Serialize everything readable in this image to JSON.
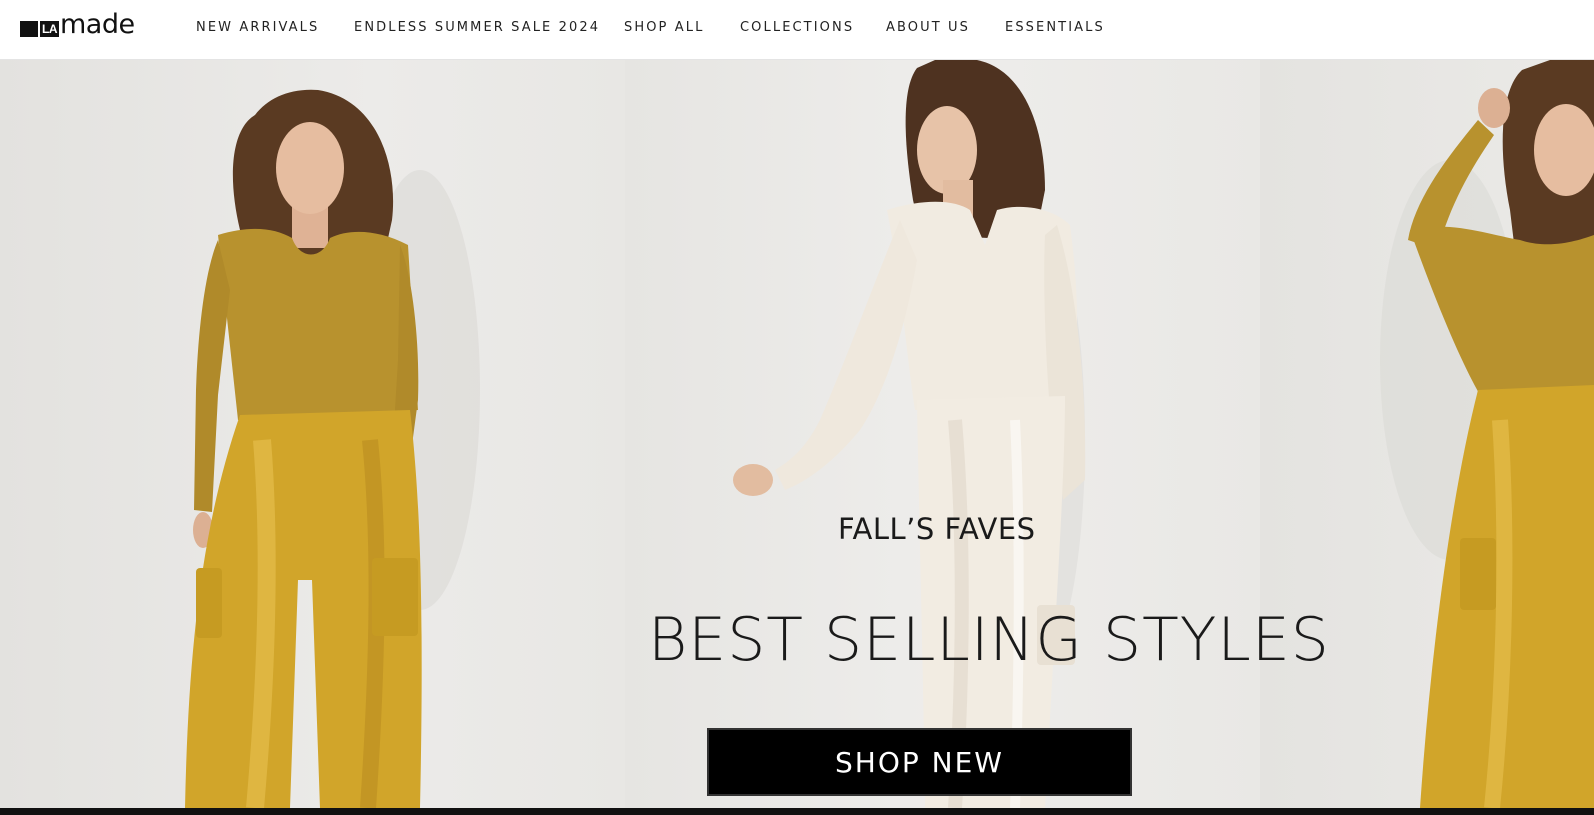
{
  "brand": {
    "logo_la": "LA",
    "logo_made": "made"
  },
  "nav": {
    "items": [
      {
        "label": "NEW ARRIVALS"
      },
      {
        "label": "ENDLESS SUMMER SALE 2024"
      },
      {
        "label": "SHOP ALL"
      },
      {
        "label": "COLLECTIONS"
      },
      {
        "label": "ABOUT US"
      },
      {
        "label": "ESSENTIALS"
      }
    ]
  },
  "hero": {
    "eyebrow": "FALL’S FAVES",
    "headline": "BEST SELLING STYLES",
    "cta_label": "SHOP NEW",
    "colors": {
      "mustard_top": "#b8922e",
      "gold_satin": "#d1a52a",
      "ivory": "#f1ebe1",
      "wall": "#eaeae7",
      "cta_bg": "#000000"
    }
  }
}
